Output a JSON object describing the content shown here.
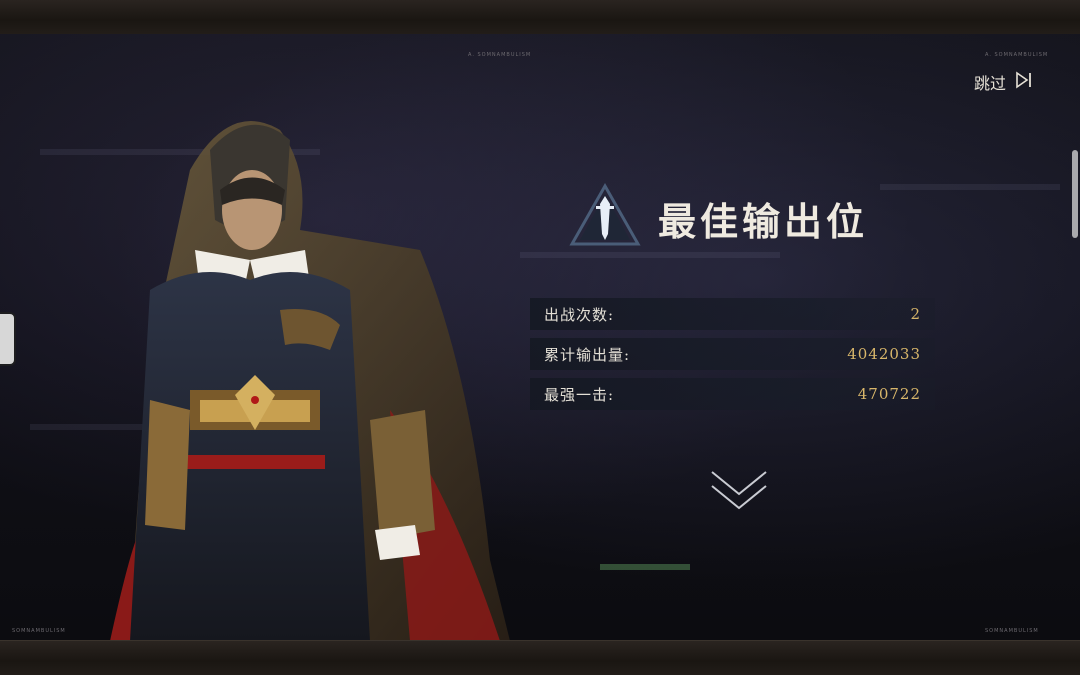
{
  "header": {
    "skip_label": "跳过"
  },
  "watermarks": {
    "top_center": "A. SOMNAMBULISM",
    "top_right": "A. SOMNAMBULISM",
    "bottom_left": "SOMNAMBULISM",
    "bottom_right": "SOMNAMBULISM"
  },
  "result": {
    "title": "最佳输出位",
    "stats": [
      {
        "label": "出战次数:",
        "value": "2"
      },
      {
        "label": "累计输出量:",
        "value": "4042033"
      },
      {
        "label": "最强一击:",
        "value": "470722"
      }
    ]
  },
  "colors": {
    "accent_gold": "#d8b66a",
    "text_light": "#efeae0",
    "emblem_blue": "#4a5d78"
  },
  "icons": {
    "skip": "skip-forward-icon",
    "emblem": "dagger-triangle-icon",
    "more": "double-chevron-down-icon"
  }
}
